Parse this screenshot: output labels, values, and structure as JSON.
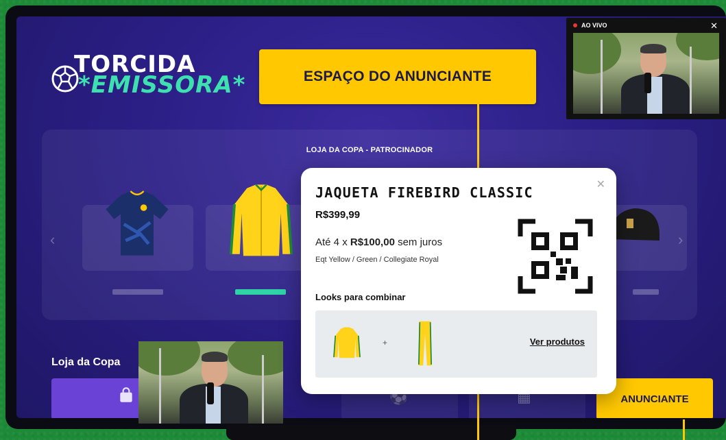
{
  "brand": {
    "logo_top": "TORCIDA",
    "logo_bottom": "*EMISSORA*"
  },
  "ad_banner": {
    "label": "ESPAÇO DO ANUNCIANTE"
  },
  "store": {
    "title": "LOJA DA COPA - PATROCINADOR",
    "selected_index": 1,
    "products": [
      {
        "icon": "jersey-icon"
      },
      {
        "icon": "jacket-icon"
      },
      {
        "icon": "item-icon"
      },
      {
        "icon": "cap-icon"
      }
    ]
  },
  "live": {
    "label": "AO VIVO",
    "close": "✕"
  },
  "bottom_bar": {
    "section_label": "Loja da Copa",
    "advertiser_label": "ANUNCIANTE"
  },
  "product_modal": {
    "title": "JAQUETA FIREBIRD CLASSIC",
    "price": "R$399,99",
    "installments_prefix": "Até 4 x ",
    "installments_value": "R$100,00",
    "installments_suffix": " sem juros",
    "color": "Eqt Yellow / Green / Collegiate Royal",
    "looks_label": "Looks para combinar",
    "plus": "+",
    "see_products": "Ver produtos",
    "close": "✕"
  },
  "colors": {
    "accent_yellow": "#ffc800",
    "accent_green": "#2ed3a6",
    "purple": "#6a43d6",
    "live_red": "#e53935"
  }
}
